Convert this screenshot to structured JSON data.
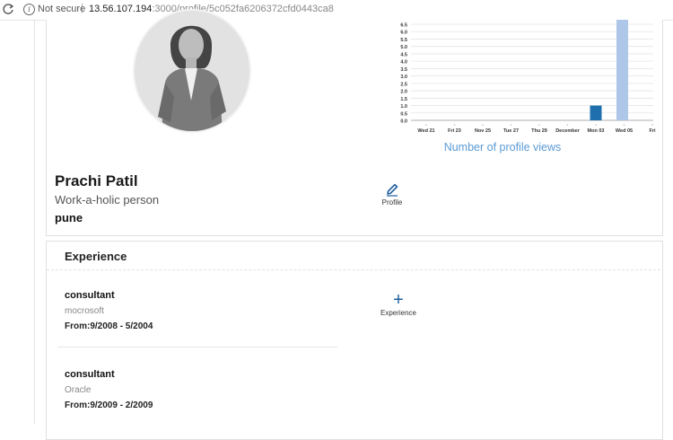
{
  "browser": {
    "security_label": "Not secure",
    "separator": "|",
    "url_host": "13.56.107.194",
    "url_path": ":3000/profile/5c052fa6206372cfd0443ca8"
  },
  "profile": {
    "name": "Prachi Patil",
    "tagline": "Work-a-holic person",
    "city": "pune",
    "edit_label": "Profile"
  },
  "chart_data": {
    "type": "bar",
    "title": "Number of profile views",
    "categories": [
      "Wed 21",
      "Fri 23",
      "Nov 25",
      "Tue 27",
      "Thu 29",
      "December",
      "Mon 03",
      "Wed 05",
      "Fri"
    ],
    "series": [
      {
        "values": [
          0,
          0,
          0,
          0,
          0,
          0,
          1,
          0,
          0
        ],
        "color": "#1f6fae"
      },
      {
        "values": [
          0,
          0,
          0,
          0,
          0,
          0,
          0,
          7,
          0
        ],
        "color": "#aec7e8"
      }
    ],
    "y_ticks": [
      "0.0",
      "0.5",
      "1.0",
      "1.5",
      "2.0",
      "2.5",
      "3.0",
      "3.5",
      "4.0",
      "4.5",
      "5.0",
      "5.5",
      "6.0",
      "6.5"
    ],
    "ylim": [
      0,
      6.5
    ],
    "grid": true
  },
  "experience": {
    "heading": "Experience",
    "add_label": "Experience",
    "items": [
      {
        "title": "consultant",
        "company": "mocrosoft",
        "period": "From:9/2008 - 5/2004"
      },
      {
        "title": "consultant",
        "company": "Oracle",
        "period": "From:9/2009 - 2/2009"
      }
    ]
  },
  "colors": {
    "accent": "#1f5f9e",
    "chart_title": "#5b9bd5",
    "bar_dark": "#1f6fae",
    "bar_light": "#aec7e8"
  }
}
